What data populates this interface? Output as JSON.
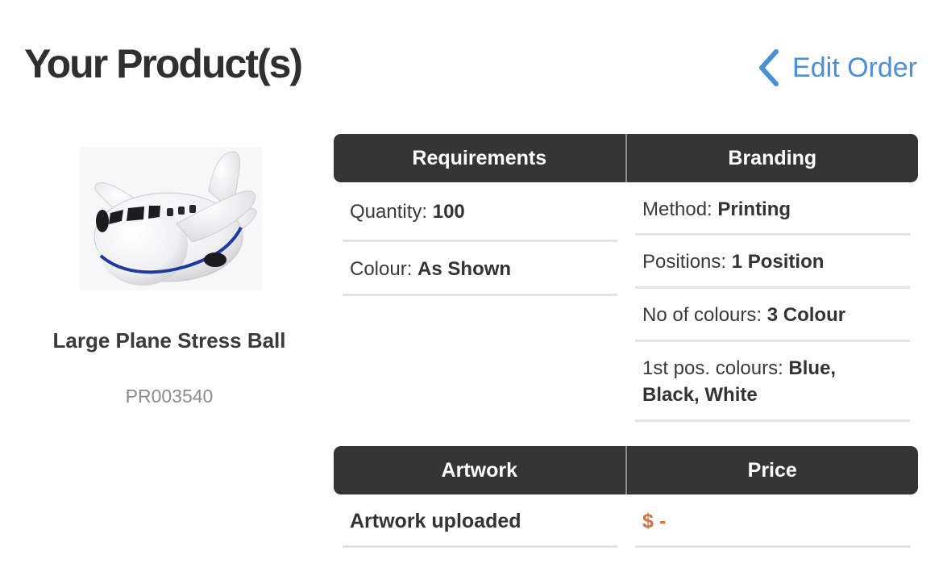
{
  "page_title": "Your Product(s)",
  "edit_order": {
    "label": "Edit Order",
    "icon": "chevron-left-icon",
    "color": "#4a90d6"
  },
  "product": {
    "name": "Large Plane Stress Ball",
    "code": "PR003540",
    "image": "plane-stress-ball-image"
  },
  "requirements": {
    "header": "Requirements",
    "rows": [
      {
        "label": "Quantity:",
        "value": "100"
      },
      {
        "label": "Colour:",
        "value": "As Shown"
      }
    ]
  },
  "branding": {
    "header": "Branding",
    "rows": [
      {
        "label": "Method:",
        "value": "Printing"
      },
      {
        "label": "Positions:",
        "value": "1 Position"
      },
      {
        "label": "No of colours:",
        "value": "3 Colour"
      },
      {
        "label": "1st pos. colours:",
        "value": "Blue, Black, White"
      }
    ]
  },
  "artwork": {
    "header": "Artwork",
    "status": "Artwork uploaded"
  },
  "price": {
    "header": "Price",
    "value": "$ -",
    "color": "#d6733a"
  },
  "colors": {
    "header_bg": "#353535",
    "divider": "#e4e4e4",
    "accent": "#4a90d6"
  }
}
